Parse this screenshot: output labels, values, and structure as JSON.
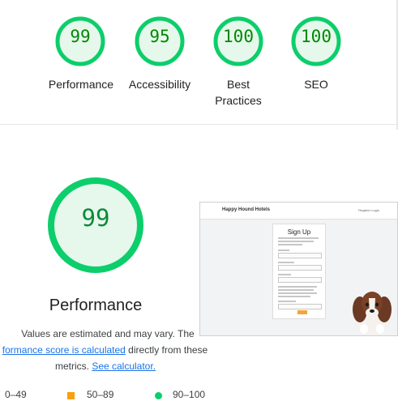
{
  "summary": {
    "gauges": [
      {
        "value": "99",
        "label_line1": "Performance",
        "label_line2": ""
      },
      {
        "value": "95",
        "label_line1": "Accessibility",
        "label_line2": ""
      },
      {
        "value": "100",
        "label_line1": "Best",
        "label_line2": "Practices"
      },
      {
        "value": "100",
        "label_line1": "SEO",
        "label_line2": ""
      }
    ]
  },
  "detail": {
    "score": "99",
    "title": "Performance",
    "note_before": "Values are estimated and may vary. The",
    "note_link1": "formance score is calculated",
    "note_middle": " directly from these",
    "note_after": "metrics.",
    "note_link2": "See calculator."
  },
  "legend": {
    "fail": "0–49",
    "average": "50–89",
    "pass": "90–100"
  },
  "thumbnail": {
    "brand": "Happy Hound Hotels",
    "nav": "Register   Login",
    "heading": "Sign Up"
  },
  "colors": {
    "pass": "#0cce6b",
    "average": "#fa9f0e",
    "pass_fill": "#e6f8ec",
    "link": "#1a73e8"
  }
}
